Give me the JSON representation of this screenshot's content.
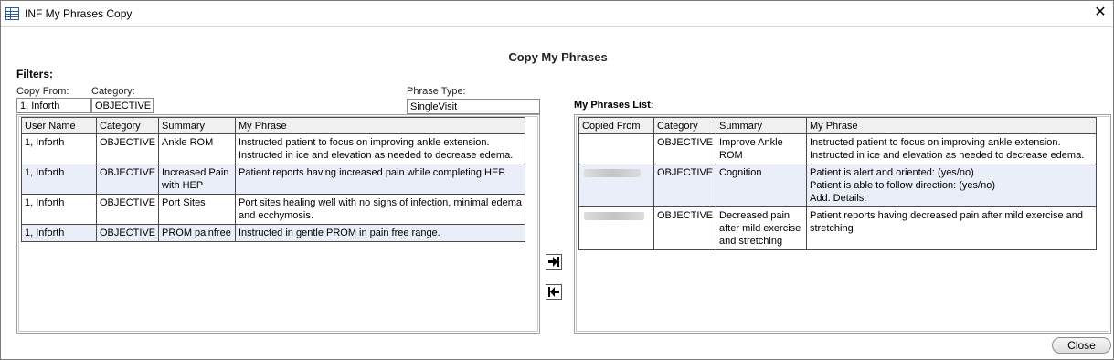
{
  "window": {
    "title": "INF My Phrases Copy"
  },
  "heading": "Copy My Phrases",
  "filters": {
    "label": "Filters:",
    "copy_from_label": "Copy From:",
    "copy_from_value": "1, Inforth",
    "category_label": "Category:",
    "category_value": "OBJECTIVE",
    "phrase_type_label": "Phrase Type:",
    "phrase_type_value": "SingleVisit"
  },
  "source_table": {
    "headers": [
      "User Name",
      "Category",
      "Summary",
      "My Phrase"
    ],
    "rows": [
      {
        "user": "1, Inforth",
        "category": "OBJECTIVE",
        "summary": "Ankle ROM",
        "phrase_lines": [
          "Instructed patient to focus on improving ankle extension.",
          "Instructed in ice and elevation as needed to decrease edema."
        ]
      },
      {
        "user": "1, Inforth",
        "category": "OBJECTIVE",
        "summary": "Increased Pain with HEP",
        "phrase_lines": [
          "Patient reports having increased pain while completing HEP."
        ]
      },
      {
        "user": "1, Inforth",
        "category": "OBJECTIVE",
        "summary": "Port Sites",
        "phrase_lines": [
          "Port sites healing well with no signs of infection, minimal edema and ecchymosis."
        ]
      },
      {
        "user": "1, Inforth",
        "category": "OBJECTIVE",
        "summary": "PROM painfree",
        "phrase_lines": [
          "Instructed in gentle PROM in pain free range."
        ]
      }
    ]
  },
  "my_phrases": {
    "label": "My Phrases List:",
    "headers": [
      "Copied From",
      "Category",
      "Summary",
      "My Phrase"
    ],
    "rows": [
      {
        "copied_from": "",
        "category": "OBJECTIVE",
        "summary": "Improve Ankle ROM",
        "phrase_lines": [
          "Instructed patient to focus on improving ankle extension.",
          "Instructed in ice and elevation as needed to decrease edema."
        ]
      },
      {
        "copied_from": "",
        "category": "OBJECTIVE",
        "summary": "Cognition",
        "phrase_lines": [
          "Patient is alert and oriented: (yes/no)",
          "Patient is able to follow direction: (yes/no)",
          "Add. Details:"
        ]
      },
      {
        "copied_from": "",
        "category": "OBJECTIVE",
        "summary": "Decreased pain after mild exercise and stretching",
        "phrase_lines": [
          "Patient reports having decreased pain after mild exercise and stretching"
        ]
      }
    ]
  },
  "buttons": {
    "add_icon": "arrow-right-to-bar-icon",
    "remove_icon": "arrow-left-to-bar-icon",
    "close_label": "Close"
  }
}
